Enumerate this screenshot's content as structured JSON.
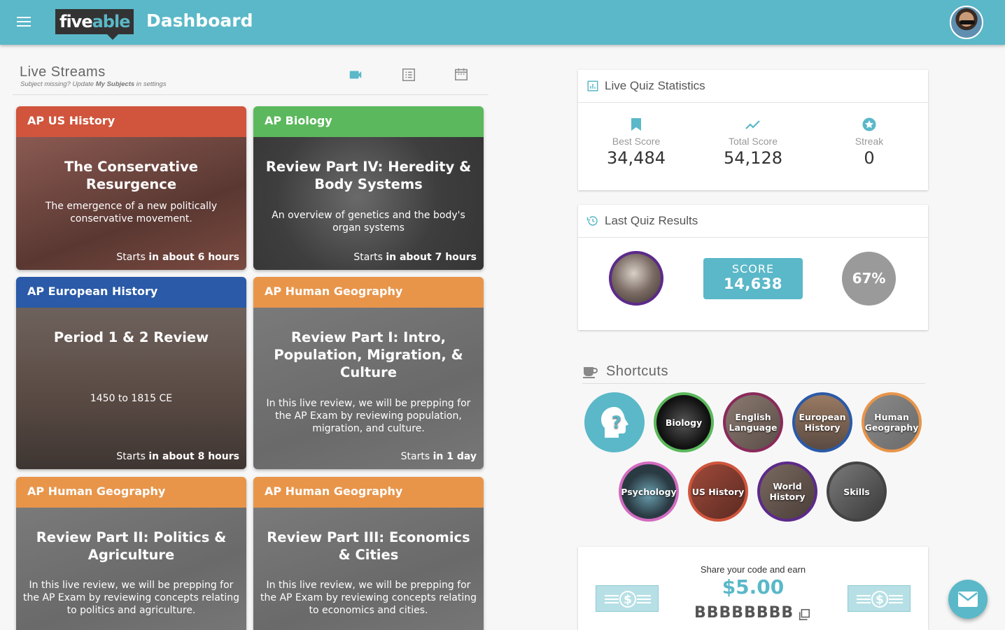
{
  "header": {
    "logo_text_a": "five",
    "logo_text_b": "able",
    "title": "Dashboard"
  },
  "live_streams": {
    "title": "Live Streams",
    "subtitle_a": "Subject missing? Update ",
    "subtitle_b": "My Subjects",
    "subtitle_c": " in settings",
    "icons": [
      "video-camera-icon",
      "list-icon",
      "calendar-icon"
    ],
    "cards": [
      {
        "subject": "AP US History",
        "title": "The Conservative Resurgence",
        "desc": "The emergence of a new politically conservative movement.",
        "starts_prefix": "Starts ",
        "starts_value": "in about 6 hours",
        "head_color": "#d0553c"
      },
      {
        "subject": "AP Biology",
        "title": "Review Part IV: Heredity & Body Systems",
        "desc": "An overview of genetics and the body's organ systems",
        "starts_prefix": "Starts ",
        "starts_value": "in about 7 hours",
        "head_color": "#5bb85c"
      },
      {
        "subject": "AP European History",
        "title": "Period 1 & 2 Review",
        "desc": "1450 to 1815 CE",
        "starts_prefix": "Starts ",
        "starts_value": "in about 8 hours",
        "head_color": "#2a5aa8"
      },
      {
        "subject": "AP Human Geography",
        "title": "Review Part I: Intro, Population, Migration, & Culture",
        "desc": "In this live review, we will be prepping for the AP Exam by reviewing population, migration, and culture.",
        "starts_prefix": "Starts ",
        "starts_value": "in 1 day",
        "head_color": "#e8954a"
      },
      {
        "subject": "AP Human Geography",
        "title": "Review Part II: Politics & Agriculture",
        "desc": "In this live review, we will be prepping for the AP Exam by reviewing concepts relating to politics and agriculture.",
        "starts_prefix": "",
        "starts_value": "",
        "head_color": "#e8954a"
      },
      {
        "subject": "AP Human Geography",
        "title": "Review Part III: Economics & Cities",
        "desc": "In this live review, we will be prepping for the AP Exam by reviewing concepts relating to economics and cities.",
        "starts_prefix": "",
        "starts_value": "",
        "head_color": "#e8954a"
      }
    ]
  },
  "quiz_stats": {
    "title": "Live Quiz Statistics",
    "best_label": "Best Score",
    "best_value": "34,484",
    "total_label": "Total Score",
    "total_value": "54,128",
    "streak_label": "Streak",
    "streak_value": "0"
  },
  "last_quiz": {
    "title": "Last Quiz Results",
    "score_label": "SCORE",
    "score_value": "14,638",
    "percent": "67%"
  },
  "shortcuts": {
    "title": "Shortcuts",
    "items": [
      {
        "label": "",
        "border": "#5ab8c8"
      },
      {
        "label": "Biology",
        "border": "#5bb85c"
      },
      {
        "label": "English Language",
        "border": "#8a2a5a"
      },
      {
        "label": "European History",
        "border": "#2a5aa8"
      },
      {
        "label": "Human Geography",
        "border": "#e8954a"
      },
      {
        "label": "Psychology",
        "border": "#d36bc0"
      },
      {
        "label": "US History",
        "border": "#d0553c"
      },
      {
        "label": "World History",
        "border": "#5c2a8a"
      },
      {
        "label": "Skills",
        "border": "#444444"
      }
    ]
  },
  "referral": {
    "text": "Share your code and earn",
    "amount": "$5.00",
    "code": "BBBBBBBB"
  },
  "colors": {
    "accent": "#5ab8c8"
  }
}
